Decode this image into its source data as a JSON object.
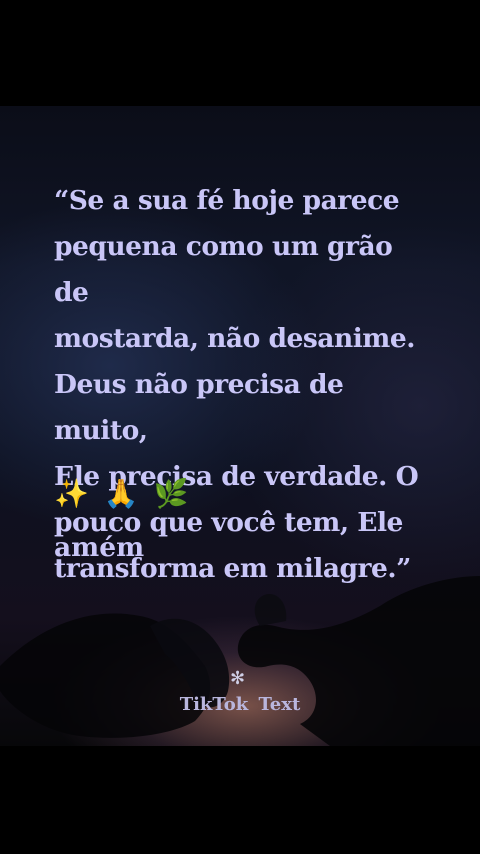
{
  "quote": {
    "text": "“Se a sua fé hoje parece\npequena como um grão de\nmostarda, não desanime.\nDeus não precisa de muito,\nEle precisa de verdade. O\npouco que você tem, Ele\ntransforma em milagre.”",
    "emojis": [
      "✨",
      "🙏",
      "🌿"
    ],
    "closing": "amém"
  },
  "watermark": {
    "symbol": "✻",
    "label": "TikTok  Text"
  },
  "colors": {
    "text": "#c9c6f7",
    "background": "#000000"
  }
}
